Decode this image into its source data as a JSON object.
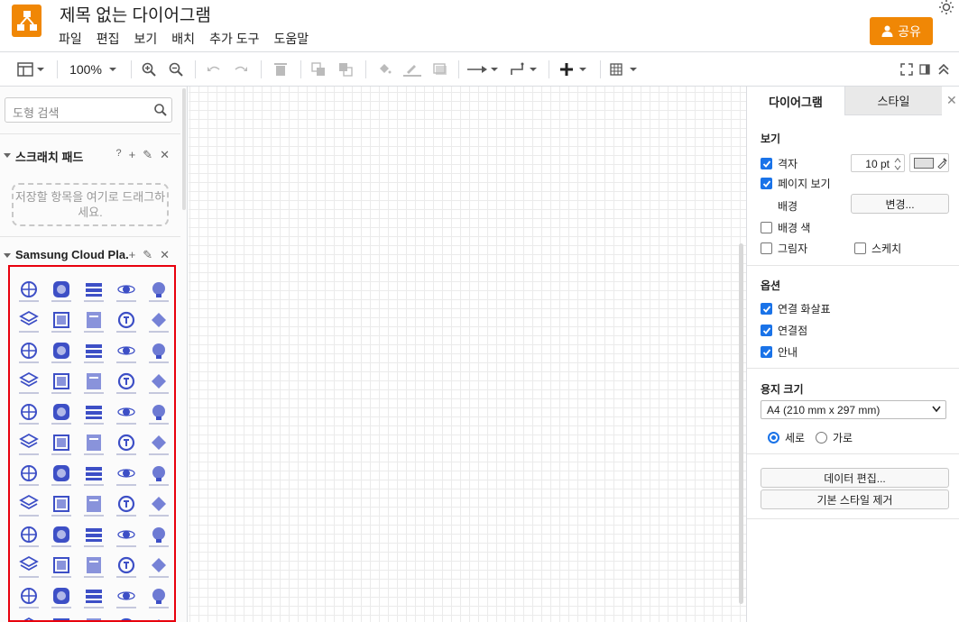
{
  "app": {
    "title": "제목 없는 다이어그램",
    "share_label": "공유"
  },
  "menu": [
    "파일",
    "편집",
    "보기",
    "배치",
    "추가 도구",
    "도움말"
  ],
  "toolbar": {
    "zoom": "100%"
  },
  "left": {
    "search_placeholder": "도형 검색",
    "scratchpad_title": "스크래치 패드",
    "scratchpad_help": "?",
    "scratchpad_hint": "저장할 항목을 여기로 드래그하세요.",
    "library_title": "Samsung Cloud Pla..."
  },
  "right": {
    "tab_diagram": "다이어그램",
    "tab_style": "스타일",
    "view_title": "보기",
    "grid_label": "격자",
    "grid_size": "10 pt",
    "page_view_label": "페이지 보기",
    "background_label": "배경",
    "change_button": "변경...",
    "bg_color_label": "배경 색",
    "shadow_label": "그림자",
    "sketch_label": "스케치",
    "options_title": "옵션",
    "connection_arrows": "연결 화살표",
    "connection_points": "연결점",
    "guides": "안내",
    "paper_size_title": "용지 크기",
    "paper_size_value": "A4 (210 mm x 297 mm)",
    "portrait": "세로",
    "landscape": "가로",
    "edit_data_button": "데이터 편집...",
    "clear_style_button": "기본 스타일 제거"
  },
  "colors": {
    "accent": "#f08705",
    "icon": "#3d4fc6",
    "selection": "#e8000d",
    "check": "#1a73e8"
  }
}
